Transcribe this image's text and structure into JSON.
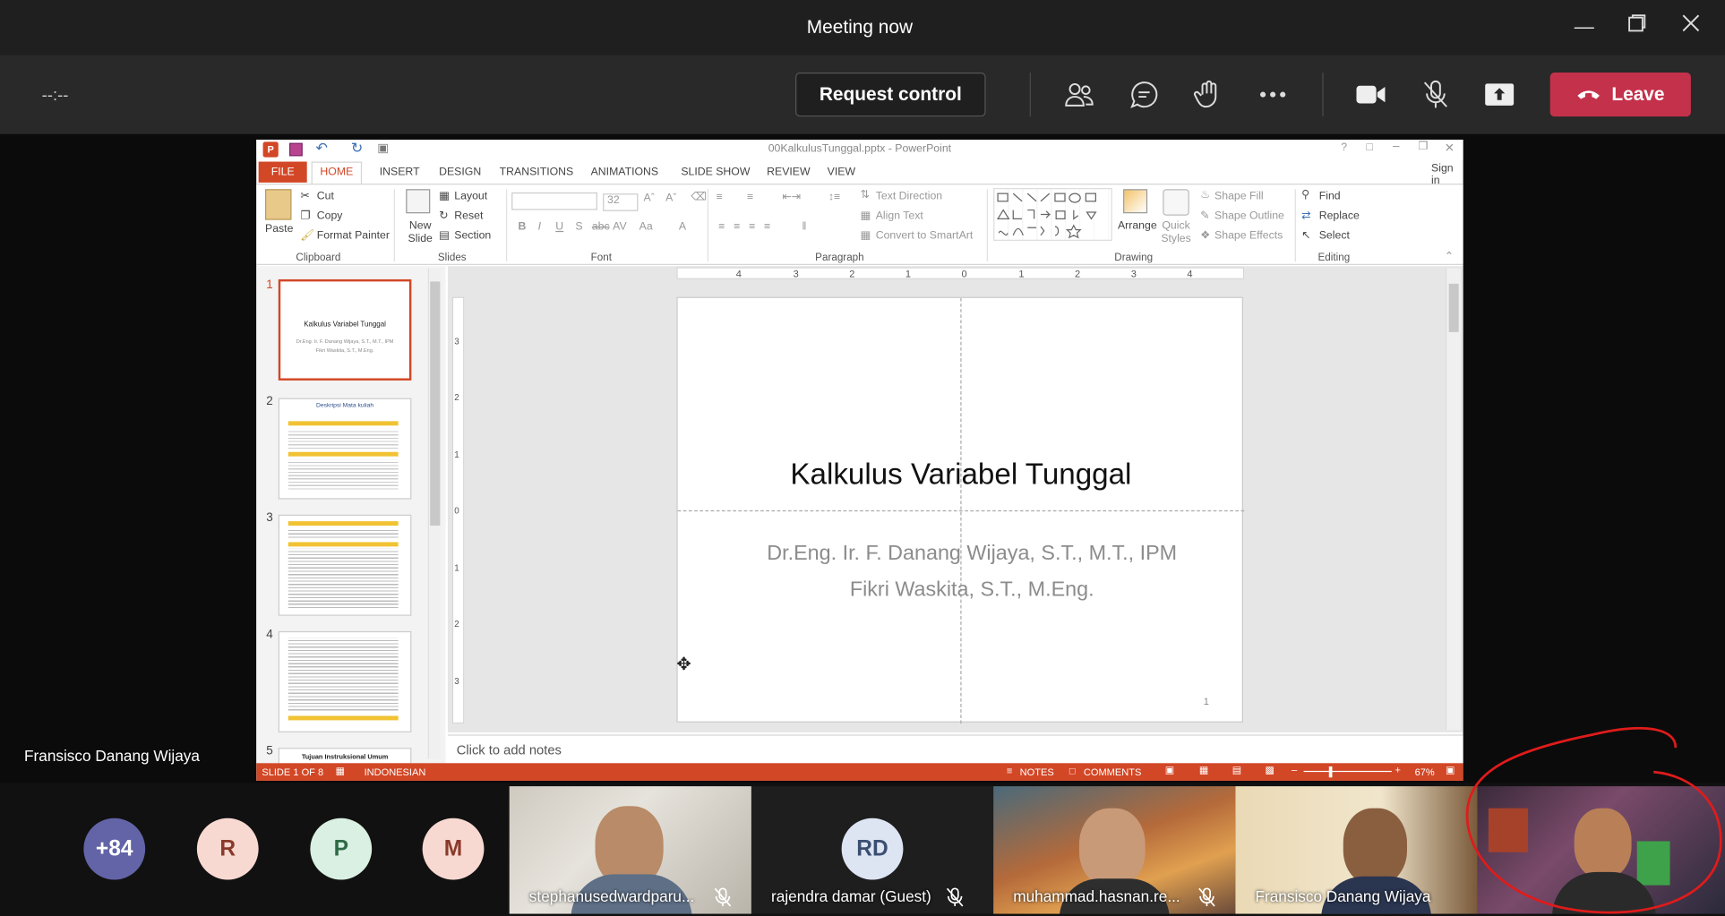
{
  "window": {
    "title": "Meeting now"
  },
  "toolbar": {
    "timer": "--:--",
    "request_control": "Request control",
    "leave": "Leave"
  },
  "presenter_label": "Fransisco Danang Wijaya",
  "ppt": {
    "doc_title": "00KalkulusTunggal.pptx - PowerPoint",
    "sign_in": "Sign in",
    "tabs": [
      "FILE",
      "HOME",
      "INSERT",
      "DESIGN",
      "TRANSITIONS",
      "ANIMATIONS",
      "SLIDE SHOW",
      "REVIEW",
      "VIEW"
    ],
    "clipboard": {
      "paste": "Paste",
      "cut": "Cut",
      "copy": "Copy",
      "format_painter": "Format Painter",
      "label": "Clipboard"
    },
    "slides_group": {
      "new_slide": "New Slide",
      "layout": "Layout",
      "reset": "Reset",
      "section": "Section",
      "label": "Slides"
    },
    "font": {
      "size": "32",
      "label": "Font"
    },
    "paragraph": {
      "text_direction": "Text Direction",
      "align_text": "Align Text",
      "convert": "Convert to SmartArt",
      "label": "Paragraph"
    },
    "drawing": {
      "arrange": "Arrange",
      "quick_styles": "Quick Styles",
      "shape_fill": "Shape Fill",
      "shape_outline": "Shape Outline",
      "shape_effects": "Shape Effects",
      "label": "Drawing"
    },
    "editing": {
      "find": "Find",
      "replace": "Replace",
      "select": "Select",
      "label": "Editing"
    },
    "thumbs": [
      {
        "num": "1",
        "title": "Kalkulus Variabel Tunggal",
        "sub1": "Dr.Eng. Ir. F. Danang Wijaya, S.T., M.T., IPM",
        "sub2": "Fikri Waskita, S.T., M.Eng."
      },
      {
        "num": "2",
        "title": "Deskripsi Mata kuliah"
      },
      {
        "num": "3"
      },
      {
        "num": "4"
      },
      {
        "num": "5",
        "title": "Tujuan Instruksional Umum"
      }
    ],
    "slide": {
      "title": "Kalkulus Variabel Tunggal",
      "author1": "Dr.Eng. Ir. F. Danang Wijaya, S.T., M.T., IPM",
      "author2": "Fikri Waskita, S.T., M.Eng.",
      "page": "1"
    },
    "ruler_top": [
      "4",
      "3",
      "2",
      "1",
      "0",
      "1",
      "2",
      "3",
      "4"
    ],
    "ruler_left": [
      "3",
      "2",
      "1",
      "0",
      "1",
      "2",
      "3"
    ],
    "notes_placeholder": "Click to add notes",
    "status": {
      "slide": "SLIDE 1 OF 8",
      "language": "INDONESIAN",
      "notes": "NOTES",
      "comments": "COMMENTS",
      "zoom": "67%"
    }
  },
  "participants": {
    "overflow": "+84",
    "avatars": [
      {
        "initial": "R",
        "bg": "#f8d9d2",
        "fg": "#8a3a2a"
      },
      {
        "initial": "P",
        "bg": "#d9f0e2",
        "fg": "#2f6b46"
      },
      {
        "initial": "M",
        "bg": "#f8d9d2",
        "fg": "#8a3a2a"
      }
    ],
    "tiles": [
      {
        "name": "stephanusedwardparu...",
        "muted": true
      },
      {
        "name": "rajendra damar (Guest)",
        "initials": "RD",
        "muted": true
      },
      {
        "name": "muhammad.hasnan.re...",
        "muted": true
      },
      {
        "name": "Fransisco Danang Wijaya",
        "muted": false
      }
    ]
  },
  "colors": {
    "leave": "#c4314b",
    "ppt_accent": "#d24726",
    "overflow_avatar": "#6264a7",
    "annotation": "#e01b1b"
  }
}
